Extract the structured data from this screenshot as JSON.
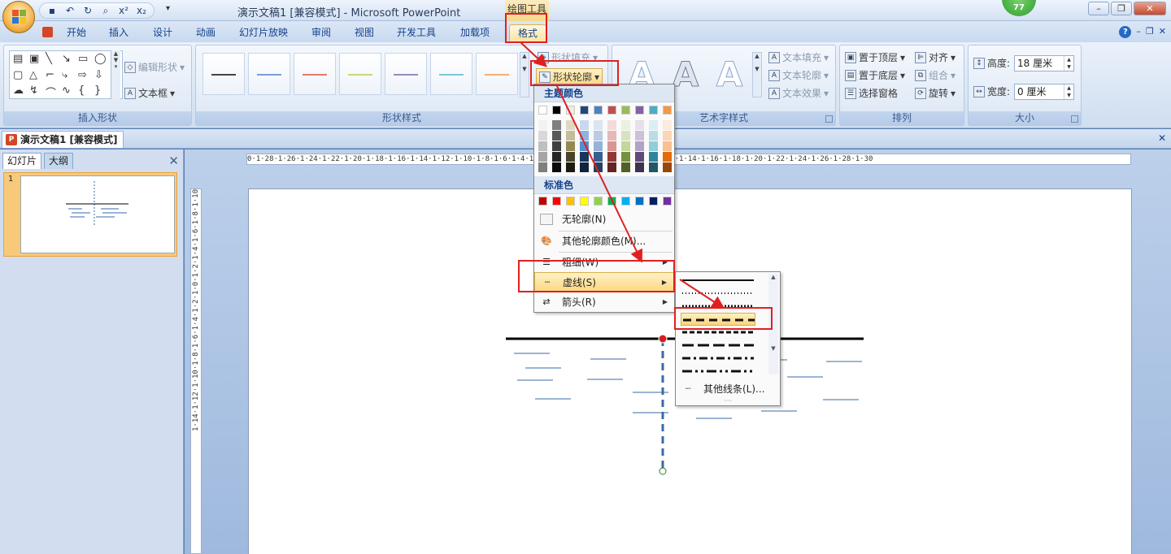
{
  "window": {
    "title": "演示文稿1 [兼容模式] - Microsoft PowerPoint",
    "context_tab_group": "绘图工具",
    "badge": "77"
  },
  "tabs": [
    "开始",
    "插入",
    "设计",
    "动画",
    "幻灯片放映",
    "审阅",
    "视图",
    "开发工具",
    "加载项",
    "格式"
  ],
  "active_tab": "格式",
  "ribbon": {
    "insert_shapes": {
      "label": "插入形状",
      "edit_shape": "编辑形状",
      "text_box": "文本框"
    },
    "shape_styles": {
      "label": "形状样式",
      "shape_fill": "形状填充",
      "shape_outline": "形状轮廓",
      "line_colors": [
        "#444444",
        "#7a9fd3",
        "#e07b6f",
        "#c9d97a",
        "#9a8bb8",
        "#7cc8d8",
        "#f4b073"
      ]
    },
    "wordart_styles": {
      "label": "艺术字样式",
      "letter": "A",
      "text_fill": "文本填充",
      "text_outline": "文本轮廓",
      "text_effect": "文本效果"
    },
    "arrange": {
      "label": "排列",
      "bring_front": "置于顶层",
      "send_back": "置于底层",
      "selection_pane": "选择窗格",
      "align": "对齐",
      "group": "组合",
      "rotate": "旋转"
    },
    "size": {
      "label": "大小",
      "height_label": "高度:",
      "height_value": "18 厘米",
      "width_label": "宽度:",
      "width_value": "0 厘米"
    }
  },
  "document_tab": "演示文稿1 [兼容模式]",
  "left_pane": {
    "tab_slides": "幻灯片",
    "tab_outline": "大纲",
    "slide_number": "1"
  },
  "ruler": {
    "horizontal": "0·1·28·1·26·1·24·1·22·1·20·1·18·1·16·1·14·1·12·1·10·1·8·1·6·1·4·1·2·1·0·1·2·1·4·1·6·1·8·1·10·1·12·1·14·1·16·1·18·1·20·1·22·1·24·1·26·1·28·1·30",
    "vertical": "1·14·1·12·1·10·1·8·1·6·1·4·1·2·1·0·1·2·1·4·1·6·1·8·1·10"
  },
  "outline_menu": {
    "theme_colors_header": "主题颜色",
    "standard_colors_header": "标准色",
    "no_outline": "无轮廓(N)",
    "more_colors": "其他轮廓颜色(M)...",
    "weight": "粗细(W)",
    "dashes": "虚线(S)",
    "arrows": "箭头(R)",
    "theme_top_row": [
      "#ffffff",
      "#000000",
      "#eeece1",
      "#1f497d",
      "#4f81bd",
      "#c0504d",
      "#9bbb59",
      "#8064a2",
      "#4bacc6",
      "#f79646"
    ],
    "theme_columns": [
      [
        "#f2f2f2",
        "#d8d8d8",
        "#bfbfbf",
        "#a5a5a5",
        "#7f7f7f"
      ],
      [
        "#7f7f7f",
        "#595959",
        "#3f3f3f",
        "#262626",
        "#0c0c0c"
      ],
      [
        "#ddd9c3",
        "#c4bd97",
        "#938953",
        "#494429",
        "#1d1b10"
      ],
      [
        "#c6d9f0",
        "#8db3e2",
        "#548dd4",
        "#17365d",
        "#0f243e"
      ],
      [
        "#dbe5f1",
        "#b8cce4",
        "#95b3d7",
        "#366092",
        "#244061"
      ],
      [
        "#f2dcdb",
        "#e5b9b7",
        "#d99694",
        "#953734",
        "#632423"
      ],
      [
        "#ebf1dd",
        "#d7e3bc",
        "#c3d69b",
        "#76923c",
        "#4f6128"
      ],
      [
        "#e5e0ec",
        "#ccc1d9",
        "#b2a2c7",
        "#5f497a",
        "#3f3151"
      ],
      [
        "#dbeef3",
        "#b7dde8",
        "#92cddc",
        "#31859b",
        "#205867"
      ],
      [
        "#fdeada",
        "#fbd5b5",
        "#fac08f",
        "#e36c09",
        "#974806"
      ]
    ],
    "standard": [
      "#c00000",
      "#ff0000",
      "#ffc000",
      "#ffff00",
      "#92d050",
      "#00b050",
      "#00b0f0",
      "#0070c0",
      "#002060",
      "#7030a0"
    ]
  },
  "dash_menu": {
    "more_lines": "其他线条(L)...",
    "selected_index": 2
  },
  "colors": {
    "annotation_red": "#e02020",
    "dashed_line": "#3a6aa8",
    "highlight": "#fbd37a"
  }
}
